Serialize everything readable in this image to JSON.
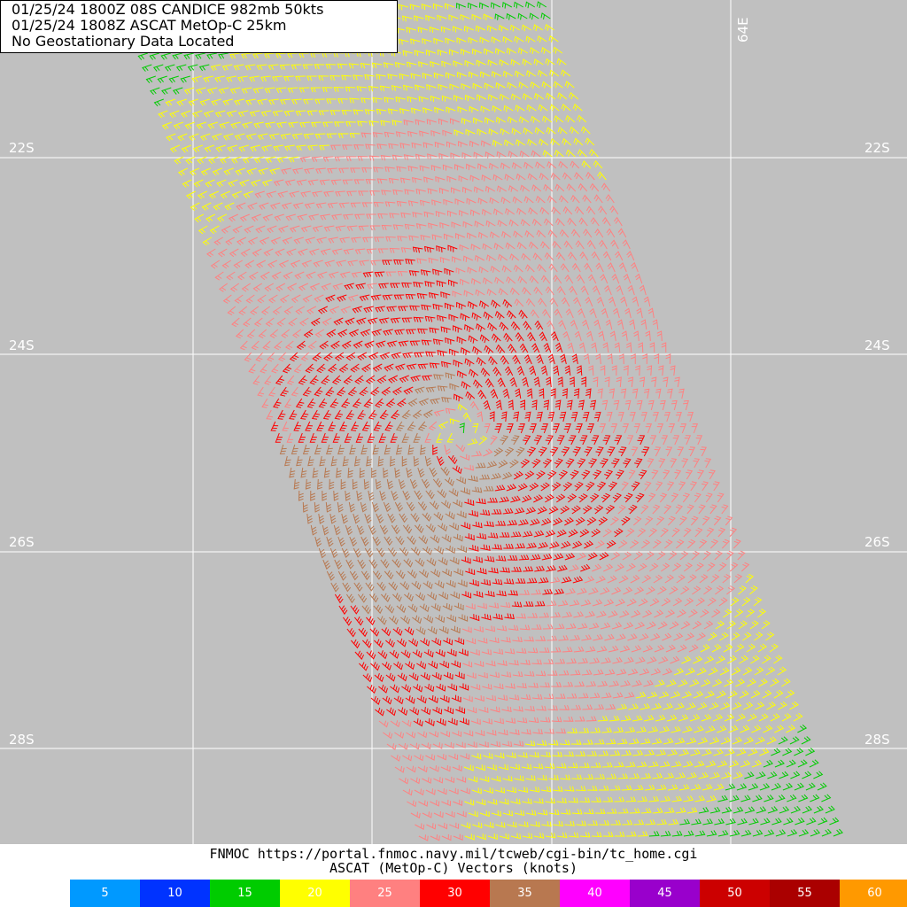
{
  "header": {
    "line1": "01/25/24 1800Z  08S CANDICE 982mb 50kts",
    "line2": "01/25/24 1808Z  ASCAT MetOp-C 25km",
    "line3": "No Geostationary Data Located"
  },
  "map": {
    "background_color": "#c0c0c0",
    "latitude_labels": [
      "22S",
      "24S",
      "26S",
      "28S"
    ],
    "longitude_labels": [
      "64E"
    ],
    "wind_barb_colors": {
      "15": "#00cc00",
      "20": "#ffff00",
      "25": "#ff8080",
      "30": "#ff0000",
      "35": "#b87850",
      "10": "#0000ff"
    },
    "storm_center": {
      "lat": "approx 25S",
      "lon": "approx 62.5E"
    }
  },
  "footer": {
    "credit": "FNMOC https://portal.fnmoc.navy.mil/tcweb/cgi-bin/tc_home.cgi",
    "product": "ASCAT (MetOp-C) Vectors (knots)"
  },
  "legend": [
    {
      "label": "5",
      "color": "#0099ff"
    },
    {
      "label": "10",
      "color": "#0033ff"
    },
    {
      "label": "15",
      "color": "#00cc00"
    },
    {
      "label": "20",
      "color": "#ffff00"
    },
    {
      "label": "25",
      "color": "#ff8080"
    },
    {
      "label": "30",
      "color": "#ff0000"
    },
    {
      "label": "35",
      "color": "#b87850"
    },
    {
      "label": "40",
      "color": "#ff00ff"
    },
    {
      "label": "45",
      "color": "#9900cc"
    },
    {
      "label": "50",
      "color": "#cc0000"
    },
    {
      "label": "55",
      "color": "#aa0000"
    },
    {
      "label": "60",
      "color": "#ff9900"
    }
  ]
}
